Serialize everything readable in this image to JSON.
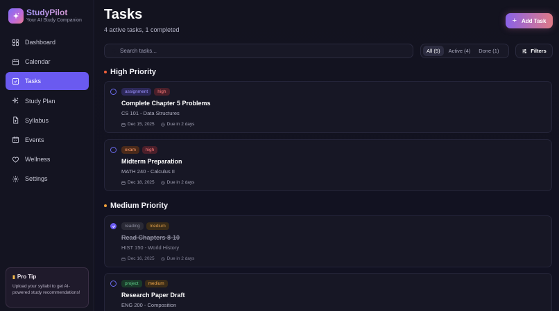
{
  "brand": {
    "name": "StudyPilot",
    "tagline": "Your AI Study Companion"
  },
  "nav": [
    {
      "label": "Dashboard",
      "icon": "dashboard-icon",
      "active": false
    },
    {
      "label": "Calendar",
      "icon": "calendar-icon",
      "active": false
    },
    {
      "label": "Tasks",
      "icon": "tasks-check-icon",
      "active": true
    },
    {
      "label": "Study Plan",
      "icon": "sparkles-icon",
      "active": false
    },
    {
      "label": "Syllabus",
      "icon": "document-upload-icon",
      "active": false
    },
    {
      "label": "Events",
      "icon": "calendar-event-icon",
      "active": false
    },
    {
      "label": "Wellness",
      "icon": "heart-icon",
      "active": false
    },
    {
      "label": "Settings",
      "icon": "gear-icon",
      "active": false
    }
  ],
  "protip": {
    "title": "Pro Tip",
    "body": "Upload your syllabi to get AI-powered study recommendations!"
  },
  "header": {
    "title": "Tasks",
    "subtitle": "4 active tasks, 1 completed",
    "add_label": "Add Task"
  },
  "search": {
    "placeholder": "Search tasks..."
  },
  "filter_tabs": [
    {
      "label": "All (5)",
      "active": true
    },
    {
      "label": "Active (4)",
      "active": false
    },
    {
      "label": "Done (1)",
      "active": false
    }
  ],
  "filters_label": "Filters",
  "colors": {
    "accent": "#6a5af0",
    "high_dot": "#f2603a",
    "medium_dot": "#f2a03a"
  },
  "sections": [
    {
      "title": "High Priority",
      "tasks": [
        {
          "category": "assignment",
          "priority": "high",
          "title": "Complete Chapter 5 Problems",
          "course": "CS 101 - Data Structures",
          "date": "Dec 15, 2025",
          "due": "Due in 2 days",
          "done": false
        },
        {
          "category": "exam",
          "priority": "high",
          "title": "Midterm Preparation",
          "course": "MATH 240 - Calculus II",
          "date": "Dec 18, 2025",
          "due": "Due in 2 days",
          "done": false
        }
      ]
    },
    {
      "title": "Medium Priority",
      "tasks": [
        {
          "category": "reading",
          "priority": "medium",
          "title": "Read Chapters 8-10",
          "course": "HIST 150 - World History",
          "date": "Dec 16, 2025",
          "due": "Due in 2 days",
          "done": true
        },
        {
          "category": "project",
          "priority": "medium",
          "title": "Research Paper Draft",
          "course": "ENG 200 - Composition",
          "date": "",
          "due": "",
          "done": false
        }
      ]
    }
  ]
}
